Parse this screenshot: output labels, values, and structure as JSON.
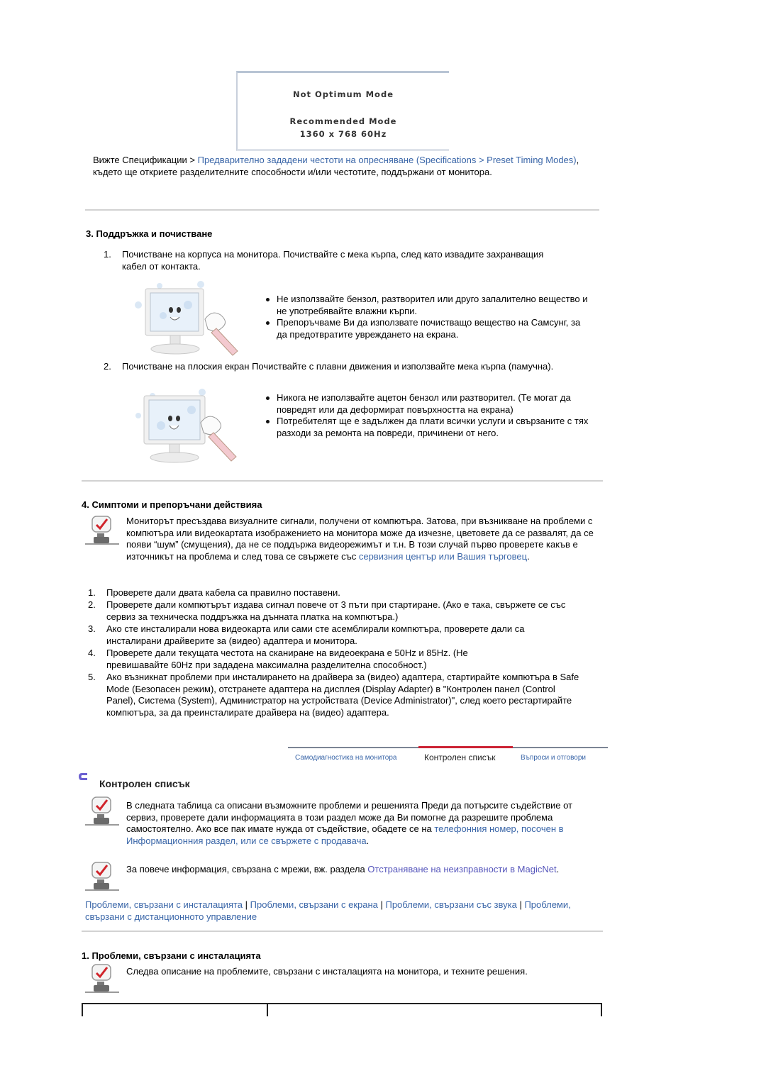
{
  "osd_image": {
    "line1": "Not Optimum Mode",
    "line2": "Recommended Mode",
    "line3": "1360 x 768  60Hz"
  },
  "spec_para": {
    "prefix": "Вижте Спецификации > ",
    "link": "Предварително зададени честоти на опресняване (Specifications > Preset Timing Modes)",
    "suffix": ", където ще откриете разделителните способности и/или честотите, поддържани от монитора."
  },
  "section3": {
    "title": "3. Поддръжка и почистване",
    "items": [
      {
        "num": "1.",
        "text": "Почистване на корпуса на монитора. Почиствайте с мека кърпа, след като извадите захранващия кабел от контакта.",
        "bullets": [
          "Не използвайте бензол, разтворител или друго запалително вещество и не употребявайте влажни кърпи.",
          "Препоръчваме Ви да използвате почистващо вещество на Самсунг, за да предотвратите увреждането на екрана."
        ]
      },
      {
        "num": "2.",
        "text": "Почистване на плоския екран Почиствайте с плавни движения и използвайте мека кърпа (памучна).",
        "bullets": [
          "Никога не използвайте ацетон бензол или разтворител. (Те могат да повредят или да деформират повърхността на екрана)",
          "Потребителят ще е задължен да плати всички услуги и свързаните с тях разходи за ремонта на повреди, причинени от него."
        ]
      }
    ]
  },
  "section4": {
    "title": "4. Симптоми и препоръчани действияа",
    "note_text": "Мониторът пресъздава визуалните сигнали, получени от компютъра. Затова, при възникване на проблеми с компютъра или видеокартата изображението на монитора може да изчезне, цветовете да се развалят, да се появи “шум” (смущения), да не се поддържа видеорежимът и т.н. В този случай първо проверете какъв е източникът на проблема и след това се свържете със ",
    "note_link": "сервизния център или Вашия търговец",
    "note_end": ".",
    "steps": [
      {
        "num": "1.",
        "text": "Проверете дали двата кабела са правилно поставени."
      },
      {
        "num": "2.",
        "text": "Проверете дали компютърът издава сигнал повече от 3 пъти при стартиране. (Ако е така, свържете се със сервиз за техническа поддръжка на дънната платка на компютъра.)"
      },
      {
        "num": "3.",
        "text": "Ако сте инсталирали нова видеокарта или сами сте асемблирали компютъра, проверете дали са инсталирани драйверите за (видео) адаптера и монитора."
      },
      {
        "num": "4.",
        "text": "Проверете дали текущата честота на сканиране на видеоекрана е 50Hz и 85Hz. (Не превишавайте 60Hz при зададена максимална разделителна способност.)"
      },
      {
        "num": "5.",
        "text": "Ако възникнат проблеми при инсталирането на драйвера за (видео) адаптера, стартирайте компютъра в Safe Mode (Безопасен режим), отстранете адаптера на дисплея (Display Adapter) в \"Контролен панел (Control Panel), Система (System), Администратор на устройствата (Device Administrator)\", след което рестартирайте компютъра, за да преинсталирате драйвера на (видео) адаптера."
      }
    ]
  },
  "tabs": {
    "items": [
      {
        "label": "Самодиагностика на монитора",
        "active": false
      },
      {
        "label": "Контролен списък",
        "active": true
      },
      {
        "label": "Въпроси и отговори",
        "active": false
      }
    ],
    "active_color": "#cc2233"
  },
  "checklist": {
    "title": "Контролен списък",
    "note1_text": "В следната таблица са описани възможните проблеми и решенията Преди да потърсите съдействие от сервиз, проверете дали информацията в този раздел може да Ви помогне да разрешите проблема самостоятелно. Ако все пак имате нужда от съдействие, обадете се на ",
    "note1_link": "телефонния номер, посочен в Информационния раздел, или се свържете с продавача",
    "note1_end": ".",
    "note2_text": "За повече информация, свързана с мрежи, вж. раздела ",
    "note2_link": "Отстраняване на неизправности в MagicNet",
    "note2_end": ".",
    "links": [
      "Проблеми, свързани с инсталацията",
      "Проблеми, свързани с екрана",
      "Проблеми, свързани със звука",
      "Проблеми, свързани с дистанционното управление"
    ],
    "separator": " | "
  },
  "install_section": {
    "title": "1. Проблеми, свързани с инсталацията",
    "note_text": "Следва описание на проблемите, свързани с инсталацията на монитора, и техните решения."
  },
  "colors": {
    "link": "#3a66a8",
    "link_magicnet": "#5555bb",
    "divider": "#d2d2d2"
  }
}
